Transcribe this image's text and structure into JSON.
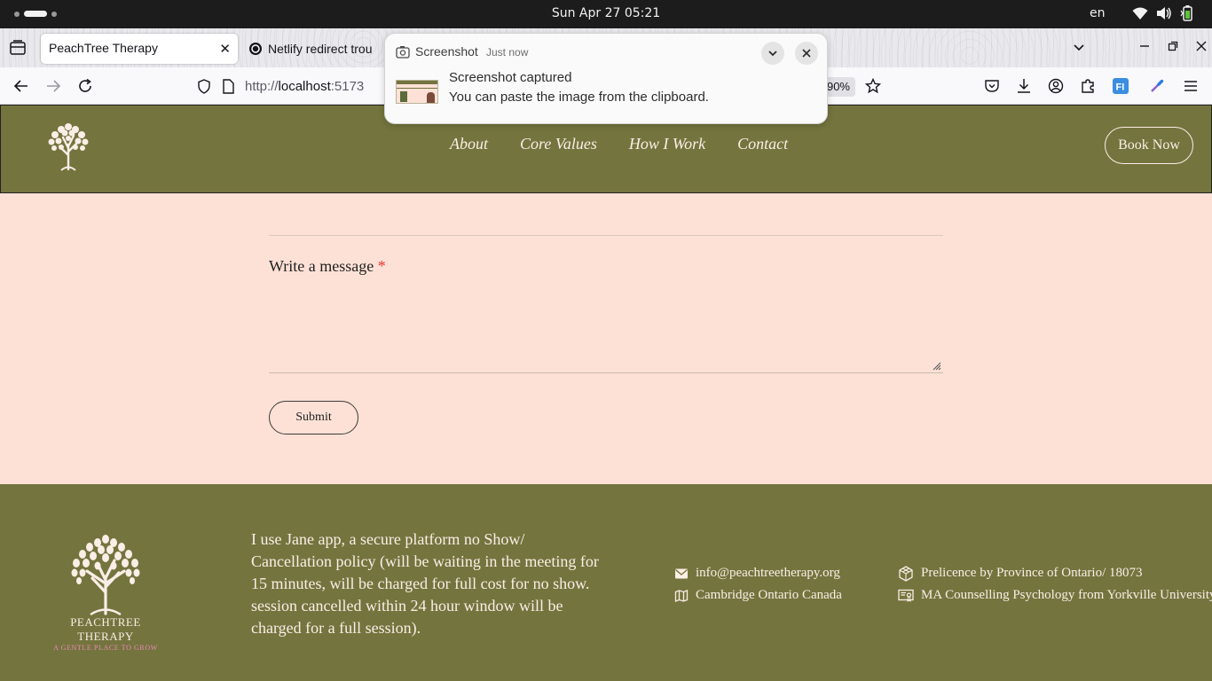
{
  "system": {
    "clock": "Sun Apr 27  05:21",
    "language": "en"
  },
  "browser": {
    "tabs": [
      {
        "title": "PeachTree Therapy",
        "active": true
      },
      {
        "title": "Netlify redirect trou",
        "active": false
      }
    ],
    "url_scheme": "http://",
    "url_host": "localhost",
    "url_port": ":5173",
    "zoom": "90%"
  },
  "notification": {
    "app_name": "Screenshot",
    "time": "Just now",
    "title": "Screenshot captured",
    "body": "You can paste the image from the clipboard."
  },
  "site": {
    "nav": [
      "About",
      "Core Values",
      "How I Work",
      "Contact"
    ],
    "book_now": "Book Now",
    "form": {
      "message_label": "Write a message",
      "required_marker": "*",
      "submit_label": "Submit"
    },
    "footer": {
      "brand_name": "PEACHTREE THERAPY",
      "brand_tagline": "A GENTLE PLACE TO GROW",
      "policy_text": "I use Jane app, a secure platform no Show/ Cancellation policy (will be waiting in the meeting for 15 minutes, will be charged for full cost for no show. session cancelled within 24 hour window will be charged for a full session).",
      "email": "info@peachtreetherapy.org",
      "location": "Cambridge Ontario Canada",
      "licence": "Prelicence by Province of Ontario/ 18073",
      "education": "MA Counselling Psychology from Yorkville University."
    }
  },
  "colors": {
    "olive": "#74743e",
    "peach": "#fee1d6",
    "cream": "#fbeee6",
    "tagline_pink": "#e88ab7"
  }
}
